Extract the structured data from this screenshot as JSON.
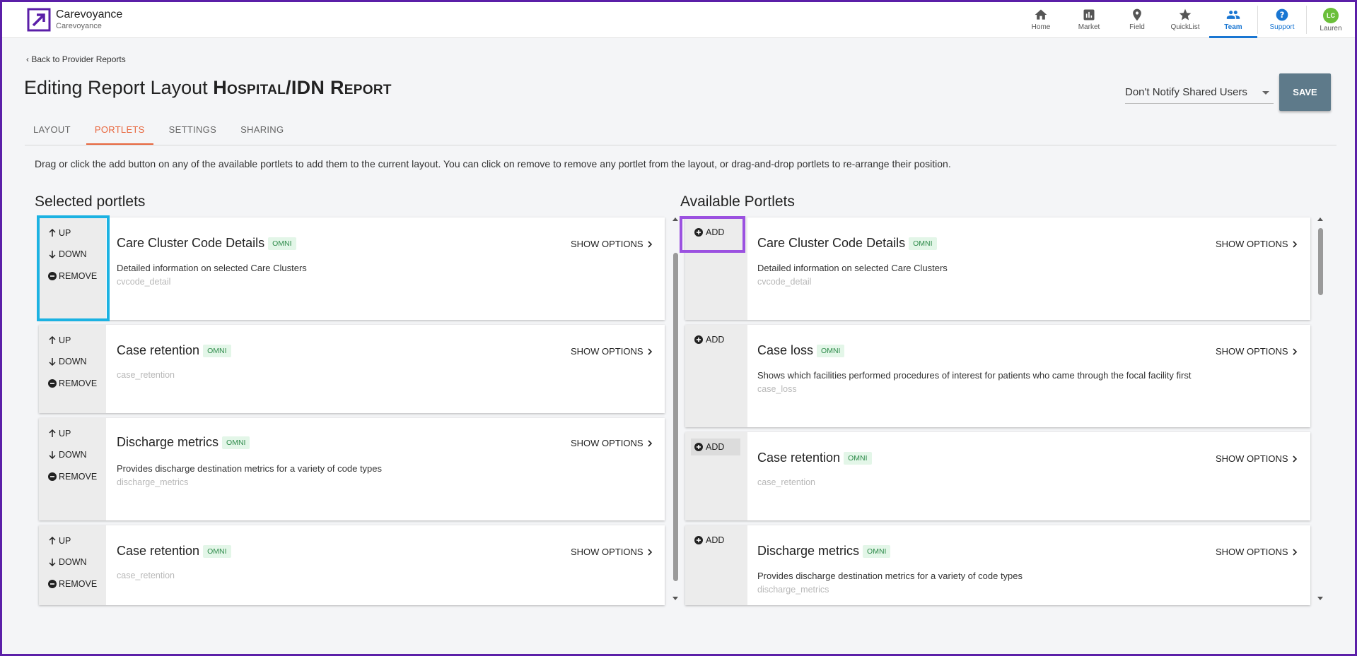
{
  "app": {
    "name": "Carevoyance",
    "subtitle": "Carevoyance"
  },
  "nav": [
    {
      "label": "Home",
      "icon": "home-icon"
    },
    {
      "label": "Market",
      "icon": "bar-chart-icon"
    },
    {
      "label": "Field",
      "icon": "map-pin-icon"
    },
    {
      "label": "QuickList",
      "icon": "star-icon"
    },
    {
      "label": "Team",
      "icon": "people-icon",
      "active": true
    },
    {
      "label": "Support",
      "icon": "help-circle-icon"
    },
    {
      "label": "Lauren",
      "icon": "avatar",
      "initials": "LC"
    }
  ],
  "back_link": "Back to Provider Reports",
  "page_title": {
    "prefix": "Editing Report Layout",
    "name": "Hospital/IDN Report"
  },
  "notify_select": {
    "value": "Don't Notify Shared Users"
  },
  "save_label": "SAVE",
  "tabs": [
    "LAYOUT",
    "PORTLETS",
    "SETTINGS",
    "SHARING"
  ],
  "active_tab": "PORTLETS",
  "instructions": "Drag or click the add button on any of the available portlets to add them to the current layout. You can click on remove to remove any portlet from the layout, or drag-and-drop portlets to re-arrange their position.",
  "selected": {
    "title": "Selected portlets",
    "up_label": "UP",
    "down_label": "DOWN",
    "remove_label": "REMOVE",
    "items": [
      {
        "title": "Care Cluster Code Details",
        "badge": "OMNI",
        "description": "Detailed information on selected Care Clusters",
        "code": "cvcode_detail"
      },
      {
        "title": "Case retention",
        "badge": "OMNI",
        "description": "",
        "code": "case_retention"
      },
      {
        "title": "Discharge metrics",
        "badge": "OMNI",
        "description": "Provides discharge destination metrics for a variety of code types",
        "code": "discharge_metrics"
      },
      {
        "title": "Case retention",
        "badge": "OMNI",
        "description": "",
        "code": "case_retention"
      }
    ]
  },
  "available": {
    "title": "Available Portlets",
    "add_label": "ADD",
    "items": [
      {
        "title": "Care Cluster Code Details",
        "badge": "OMNI",
        "description": "Detailed information on selected Care Clusters",
        "code": "cvcode_detail"
      },
      {
        "title": "Case loss",
        "badge": "OMNI",
        "description": "Shows which facilities performed procedures of interest for patients who came through the focal facility first",
        "code": "case_loss"
      },
      {
        "title": "Case retention",
        "badge": "OMNI",
        "description": "",
        "code": "case_retention"
      },
      {
        "title": "Discharge metrics",
        "badge": "OMNI",
        "description": "Provides discharge destination metrics for a variety of code types",
        "code": "discharge_metrics"
      }
    ]
  },
  "show_options_label": "SHOW OPTIONS",
  "colors": {
    "accent": "#e8663d",
    "nav_active": "#1976d2",
    "save_bg": "#5e7a8a",
    "omni_text": "#2e8b4a",
    "omni_bg": "#e3f6e8",
    "highlight_blue": "#1bb2e2",
    "highlight_purple": "#9b51e0"
  }
}
